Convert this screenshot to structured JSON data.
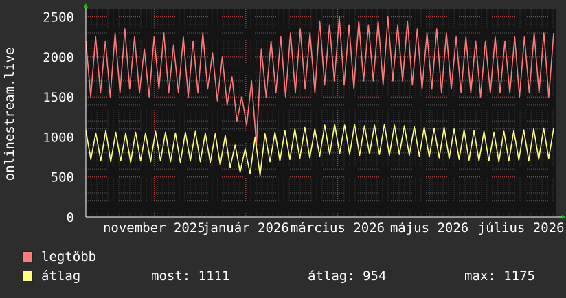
{
  "chart_data": {
    "type": "line",
    "ylabel": "onlinestream.live",
    "ylim": [
      0,
      2600
    ],
    "y_ticks": [
      "0",
      "500",
      "1000",
      "1500",
      "2000",
      "2500"
    ],
    "x_ticks": [
      "november 2025",
      "január 2026",
      "március 2026",
      "május 2026",
      "július 2026"
    ],
    "grid": true,
    "background": "#141414",
    "grid_color": "#5a5a5a",
    "series": [
      {
        "name": "legtöbb",
        "color": "#ff7b7b",
        "values": [
          2200,
          1500,
          2250,
          1550,
          2200,
          1500,
          2300,
          1550,
          2350,
          1600,
          2250,
          1550,
          2100,
          1500,
          2250,
          1600,
          2300,
          1550,
          2150,
          1550,
          2250,
          1500,
          2200,
          1550,
          2300,
          1600,
          2050,
          1450,
          2000,
          1400,
          1750,
          1200,
          1500,
          1150,
          1700,
          900,
          2100,
          1500,
          2200,
          1550,
          2250,
          1500,
          2300,
          1550,
          2350,
          1600,
          2300,
          1550,
          2450,
          1650,
          2400,
          1700,
          2500,
          1650,
          2400,
          1600,
          2450,
          1700,
          2400,
          1700,
          2450,
          1650,
          2500,
          1700,
          2400,
          1700,
          2450,
          1650,
          2350,
          1600,
          2300,
          1600,
          2350,
          1550,
          2300,
          1600,
          2250,
          1550,
          2250,
          1550,
          2200,
          1500,
          2200,
          1550,
          2250,
          1550,
          2200,
          1550,
          2250,
          1500,
          2250,
          1550,
          2300,
          1550,
          2300,
          1500,
          2300
        ]
      },
      {
        "name": "átlag",
        "color": "#ffff7b",
        "values": [
          1080,
          720,
          1050,
          700,
          1080,
          690,
          1060,
          700,
          1050,
          680,
          1060,
          700,
          1050,
          690,
          1070,
          700,
          1060,
          690,
          1050,
          680,
          1060,
          700,
          1070,
          690,
          1050,
          680,
          1040,
          650,
          1020,
          620,
          900,
          560,
          850,
          540,
          1000,
          520,
          1040,
          690,
          1060,
          700,
          1080,
          720,
          1100,
          730,
          1120,
          740,
          1100,
          760,
          1150,
          780,
          1160,
          790,
          1150,
          780,
          1160,
          770,
          1140,
          790,
          1150,
          780,
          1160,
          770,
          1150,
          780,
          1140,
          770,
          1130,
          760,
          1120,
          750,
          1110,
          740,
          1120,
          730,
          1100,
          720,
          1090,
          710,
          1080,
          700,
          1070,
          700,
          1060,
          690,
          1070,
          700,
          1080,
          710,
          1090,
          700,
          1100,
          720,
          1110,
          730,
          1110
        ]
      }
    ]
  },
  "legend": [
    {
      "label": "legtöbb",
      "color": "#ff7b7b"
    },
    {
      "label": "átlag",
      "color": "#ffff7b"
    }
  ],
  "stats": {
    "most": "most: 1111",
    "atlag": "átlag: 954",
    "max": "max: 1175"
  }
}
